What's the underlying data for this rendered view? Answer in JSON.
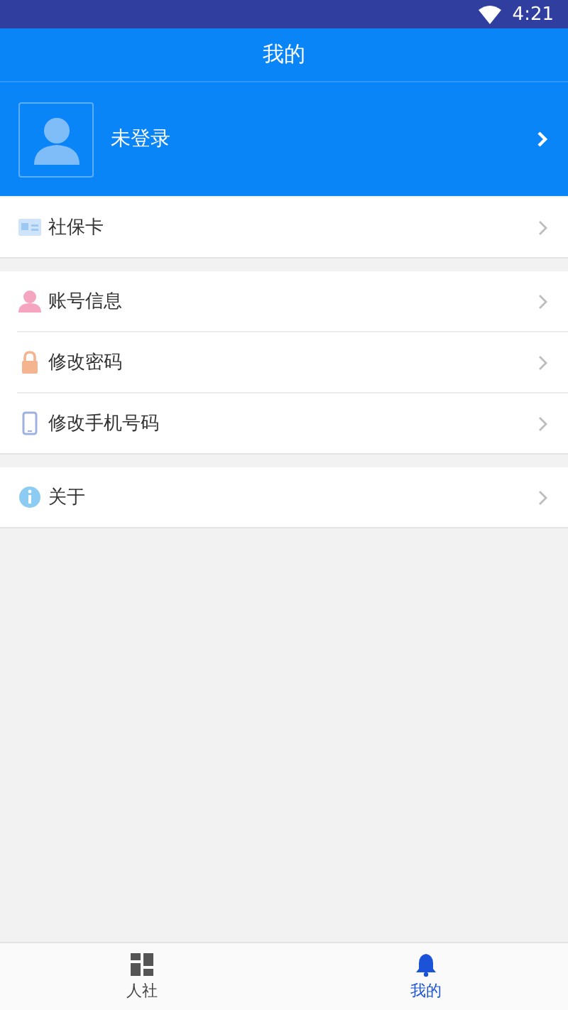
{
  "status_bar": {
    "time": "4:21"
  },
  "title_bar": {
    "title": "我的"
  },
  "profile": {
    "name": "未登录"
  },
  "menu_groups": [
    {
      "items": [
        {
          "label": "社保卡",
          "kind": "card"
        }
      ]
    },
    {
      "items": [
        {
          "label": "账号信息",
          "kind": "person"
        },
        {
          "label": "修改密码",
          "kind": "lock"
        },
        {
          "label": "修改手机号码",
          "kind": "phone"
        }
      ]
    },
    {
      "items": [
        {
          "label": "关于",
          "kind": "info"
        }
      ]
    }
  ],
  "bottom_nav": [
    {
      "label": "人社",
      "kind": "grid",
      "selected": false
    },
    {
      "label": "我的",
      "kind": "bell",
      "selected": true
    }
  ]
}
